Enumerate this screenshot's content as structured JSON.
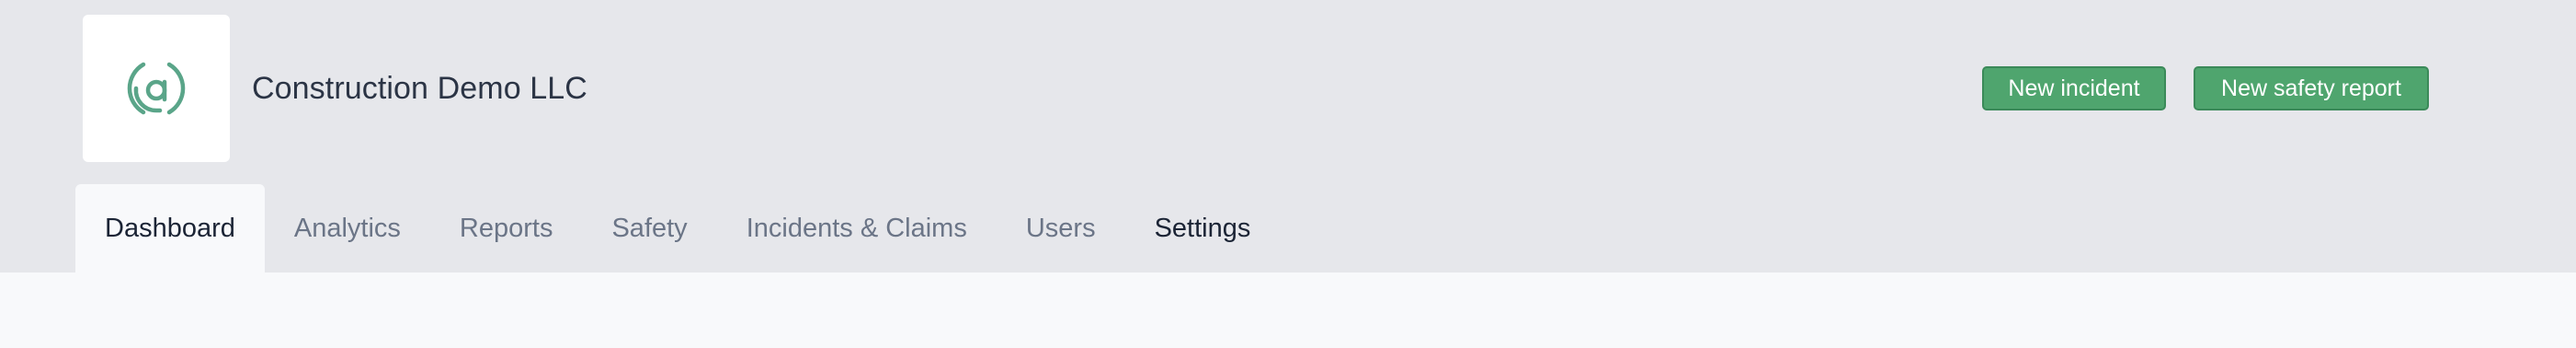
{
  "header": {
    "logo_icon": "at-sign-logo-icon",
    "company_name": "Construction Demo LLC",
    "brand_color": "#4fa56e",
    "buttons": {
      "new_incident": "New incident",
      "new_safety_report": "New safety report"
    }
  },
  "tabs": [
    {
      "label": "Dashboard",
      "active": true
    },
    {
      "label": "Analytics",
      "active": false
    },
    {
      "label": "Reports",
      "active": false
    },
    {
      "label": "Safety",
      "active": false
    },
    {
      "label": "Incidents & Claims",
      "active": false
    },
    {
      "label": "Users",
      "active": false
    },
    {
      "label": "Settings",
      "active": false
    }
  ]
}
